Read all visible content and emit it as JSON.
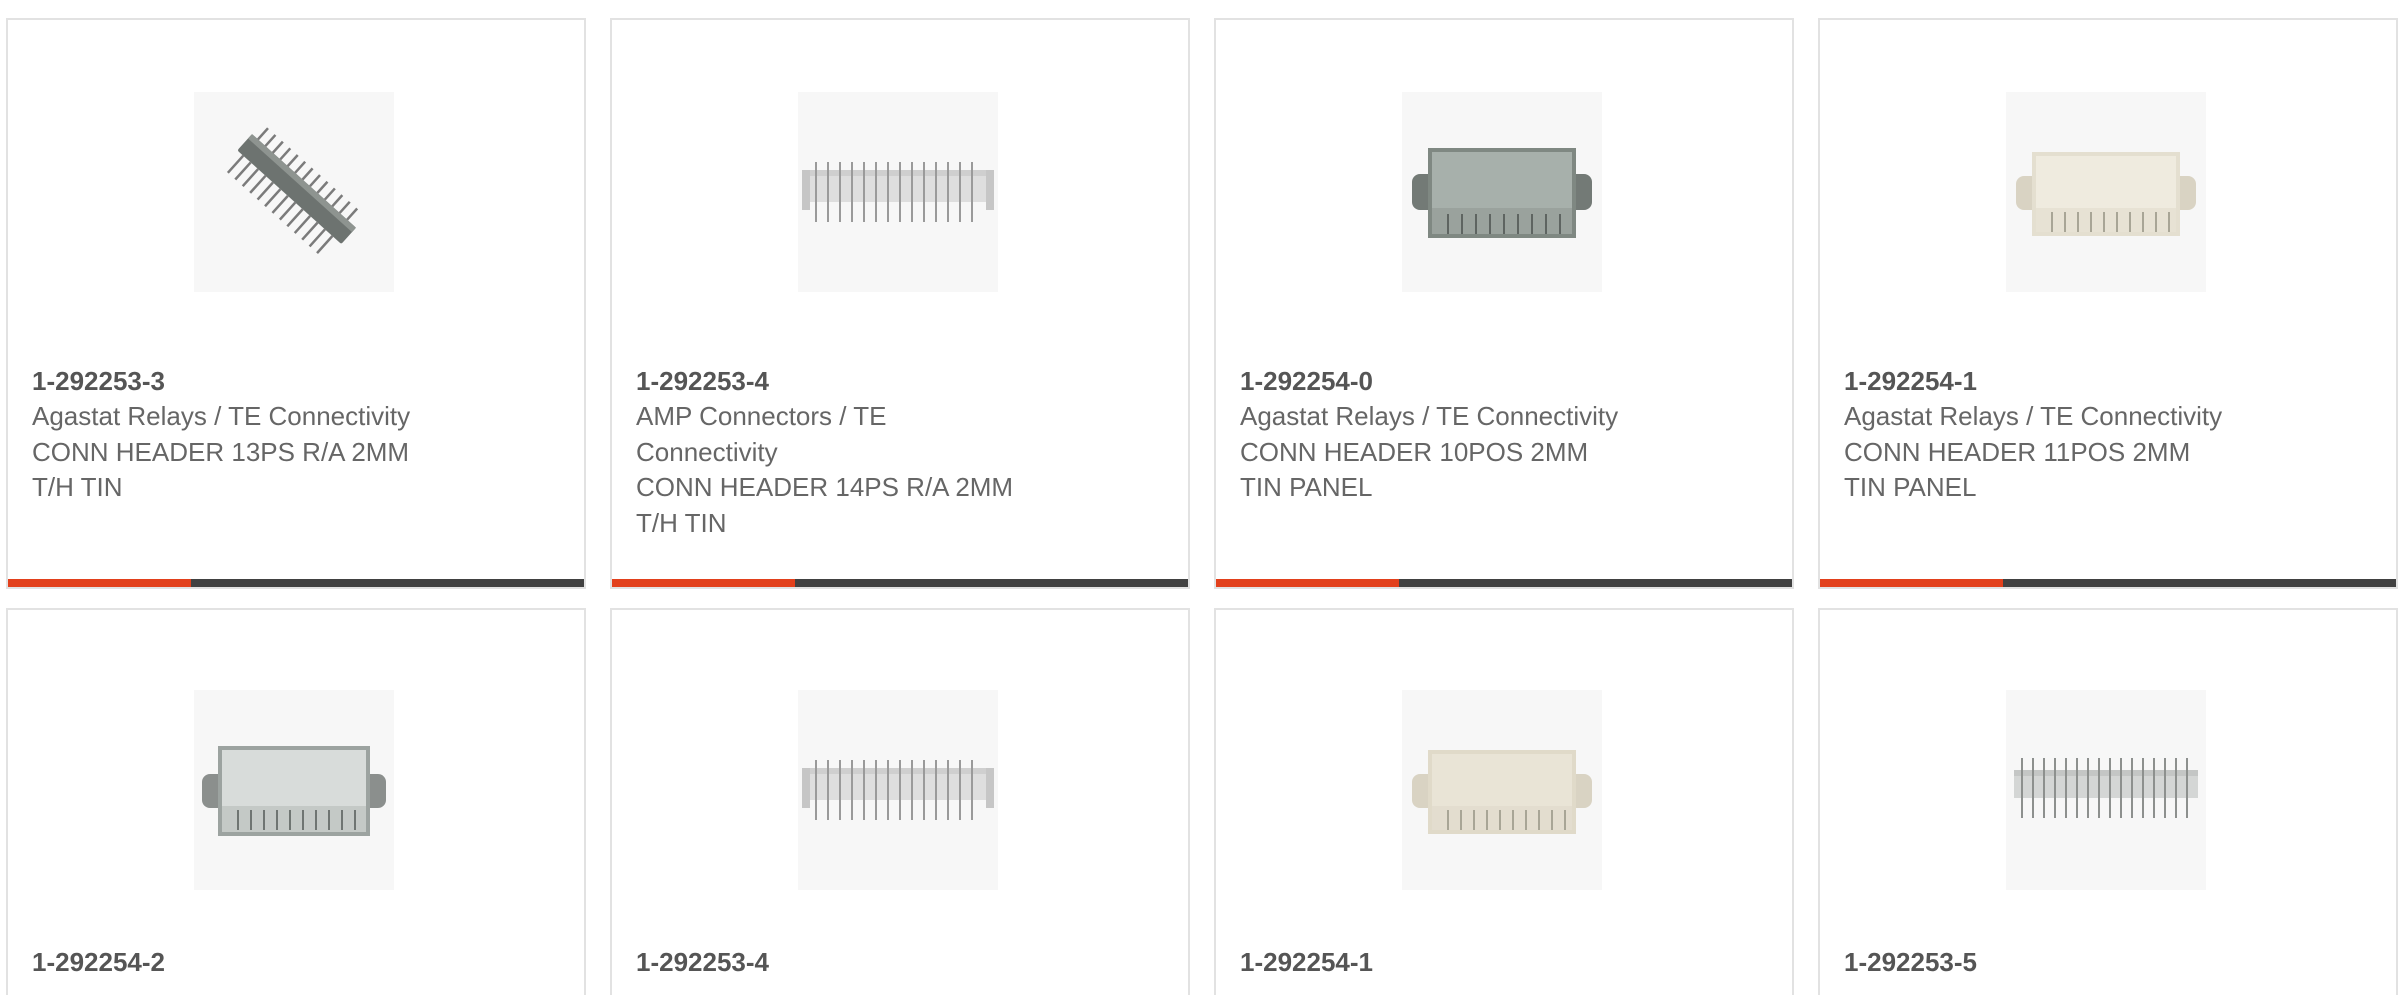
{
  "accent_color": "#e2401c",
  "bar_color": "#414141",
  "products": [
    {
      "part_number": "1-292253-3",
      "manufacturer": "Agastat Relays / TE Connectivity",
      "description": "CONN HEADER 13PS R/A 2MM T/H TIN",
      "image_icon": "angled-pin-header-icon"
    },
    {
      "part_number": "1-292253-4",
      "manufacturer": "AMP Connectors / TE Connectivity",
      "description": "CONN HEADER 14PS R/A 2MM T/H TIN",
      "image_icon": "pin-header-icon"
    },
    {
      "part_number": "1-292254-0",
      "manufacturer": "Agastat Relays / TE Connectivity",
      "description": "CONN HEADER 10POS 2MM TIN PANEL",
      "image_icon": "gray-panel-connector-icon"
    },
    {
      "part_number": "1-292254-1",
      "manufacturer": "Agastat Relays / TE Connectivity",
      "description": "CONN HEADER 11POS 2MM TIN PANEL",
      "image_icon": "beige-panel-connector-icon"
    },
    {
      "part_number": "1-292254-2",
      "image_icon": "gray-panel-connector-icon"
    },
    {
      "part_number": "1-292253-4",
      "image_icon": "pin-header-icon"
    },
    {
      "part_number": "1-292254-1",
      "image_icon": "beige-panel-connector-icon"
    },
    {
      "part_number": "1-292253-5",
      "image_icon": "pin-header-icon"
    }
  ]
}
